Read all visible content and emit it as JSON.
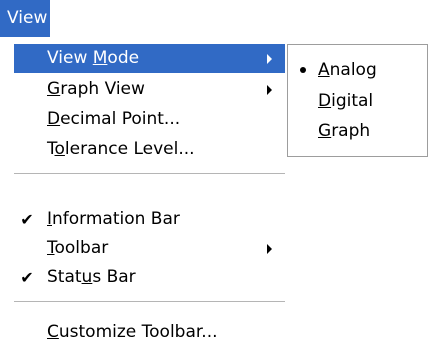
{
  "menubar": {
    "view_label": "View",
    "view_mnemonic": "V"
  },
  "menu": {
    "items": [
      {
        "label": "View Mode",
        "mnemonic": "M",
        "has_submenu": true,
        "checked": false,
        "highlighted": true
      },
      {
        "label": "Graph View",
        "mnemonic": "G",
        "has_submenu": true,
        "checked": false
      },
      {
        "label": "Decimal Point...",
        "mnemonic": "D",
        "has_submenu": false,
        "checked": false
      },
      {
        "label": "Tolerance Level...",
        "mnemonic": "o",
        "has_submenu": false,
        "checked": false
      },
      {
        "label": "Information Bar",
        "mnemonic": "I",
        "has_submenu": false,
        "checked": true
      },
      {
        "label": "Toolbar",
        "mnemonic": "T",
        "has_submenu": true,
        "checked": false
      },
      {
        "label": "Status Bar",
        "mnemonic": "u",
        "has_submenu": false,
        "checked": true
      },
      {
        "label": "Customize Toolbar...",
        "mnemonic": "C",
        "has_submenu": false,
        "checked": false
      }
    ],
    "check_glyph": "✔"
  },
  "submenu": {
    "items": [
      {
        "label": "Analog",
        "mnemonic": "A",
        "selected": true
      },
      {
        "label": "Digital",
        "mnemonic": "D",
        "selected": false
      },
      {
        "label": "Graph",
        "mnemonic": "G",
        "selected": false
      }
    ]
  },
  "colors": {
    "highlight": "#316ac5",
    "highlight_text": "#ffffff",
    "separator": "#b5b5b5",
    "submenu_border": "#9d9d9d"
  }
}
